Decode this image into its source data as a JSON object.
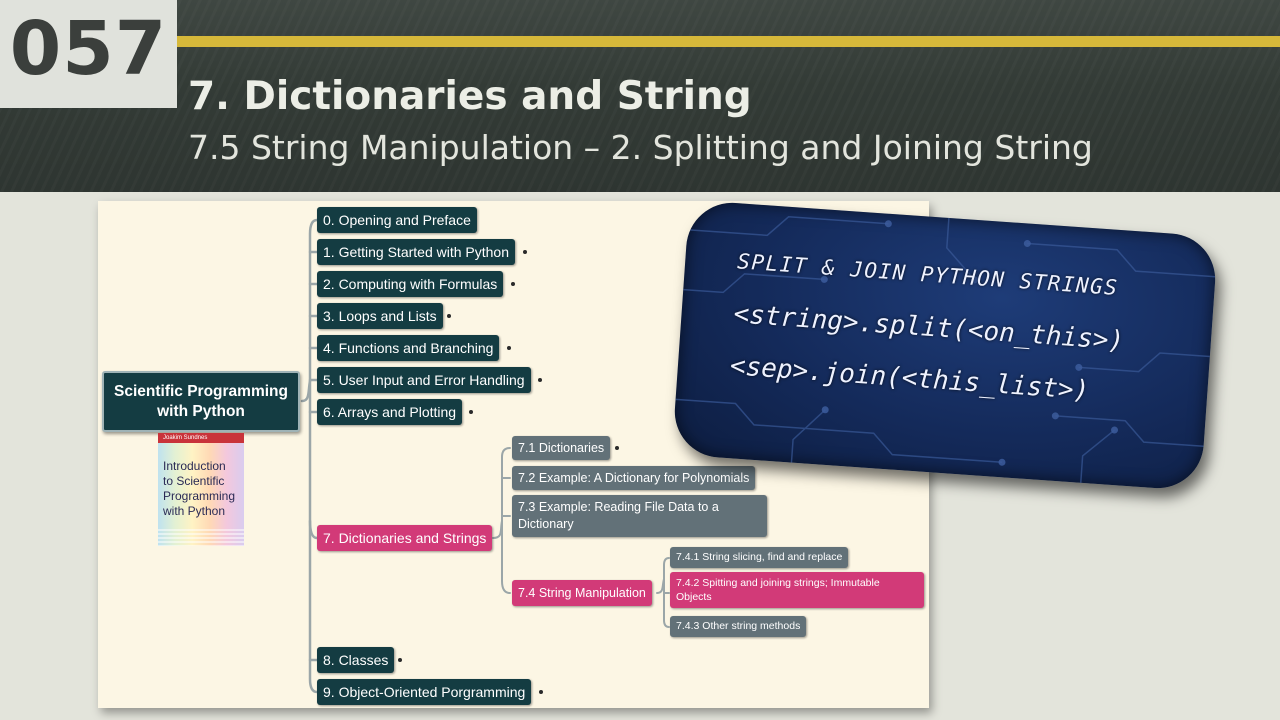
{
  "slide": {
    "number": "057",
    "title": "7. Dictionaries and String",
    "subtitle": "7.5 String Manipulation – 2. Splitting and Joining String",
    "colors": {
      "header": "#333b36",
      "accent": "#d6b83a",
      "background": "#e3e4db",
      "panel": "#fcf6e4"
    }
  },
  "mindmap": {
    "root": {
      "line1": "Scientific Programming",
      "line2": "with Python"
    },
    "book": {
      "author": "Joakim Sundnes",
      "title_lines": [
        "Introduction",
        "to Scientific",
        "Programming",
        "with Python"
      ]
    },
    "chapters": [
      "0. Opening and Preface",
      "1. Getting Started with Python",
      "2. Computing with Formulas",
      "3. Loops and Lists",
      "4. Functions and Branching",
      "5. User Input and Error Handling",
      "6. Arrays and Plotting",
      "7. Dictionaries and Strings",
      "8. Classes",
      "9. Object-Oriented Porgramming"
    ],
    "chapter7_sections": [
      "7.1 Dictionaries",
      "7.2 Example: A Dictionary for Polynomials",
      "7.3 Example: Reading File Data to a Dictionary",
      "7.4 String Manipulation"
    ],
    "section74_subsections": [
      "7.4.1 String slicing, find and replace",
      "7.4.2 Spitting and joining strings; Immutable Objects",
      "7.4.3 Other string methods"
    ],
    "colors": {
      "node": "#143c42",
      "subnode": "#627178",
      "highlight": "#d23a78"
    }
  },
  "code_card": {
    "line1": "SPLIT & JOIN PYTHON STRINGS",
    "line2": "<string>.split(<on_this>)",
    "line3": "<sep>.join(<this_list>)",
    "colors": {
      "background": "#142a5a",
      "text": "#eef2ff"
    }
  }
}
